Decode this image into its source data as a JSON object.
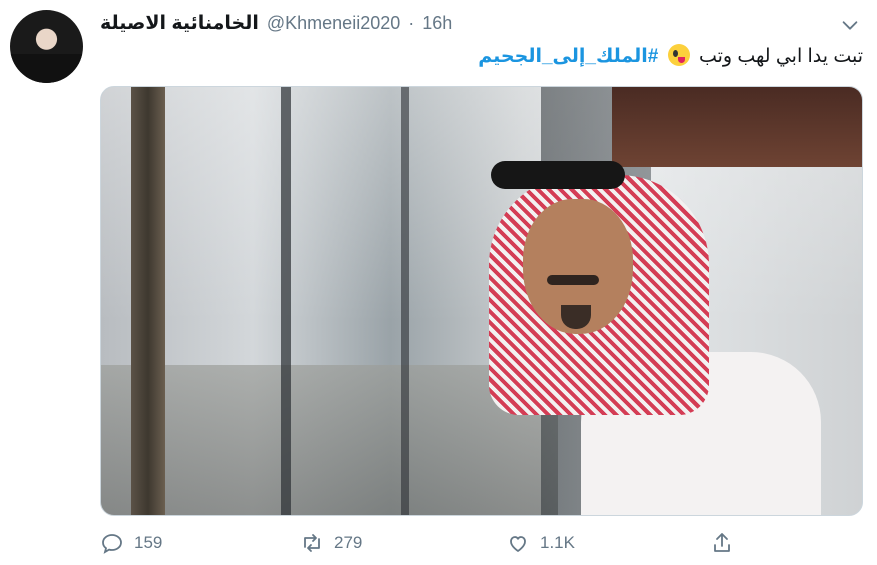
{
  "tweet": {
    "display_name": "الخامنائية الاصيلة",
    "handle": "@Khmeneii2020",
    "separator": "·",
    "time": "16h",
    "text": {
      "plain": "تبت يدا ابي لهب وتب",
      "hashtag": "#الملك_إلى_الجحيم",
      "emoji": "zany-face-emoji"
    },
    "media": {
      "kind": "photo"
    },
    "metrics": {
      "replies": "159",
      "retweets": "279",
      "likes": "1.1K"
    }
  },
  "colors": {
    "link": "#1b95e0",
    "muted": "#657786",
    "text": "#14171a",
    "border": "#ccd6dd"
  },
  "icons": [
    "chevron-down-icon",
    "reply-icon",
    "retweet-icon",
    "like-icon",
    "share-icon"
  ]
}
